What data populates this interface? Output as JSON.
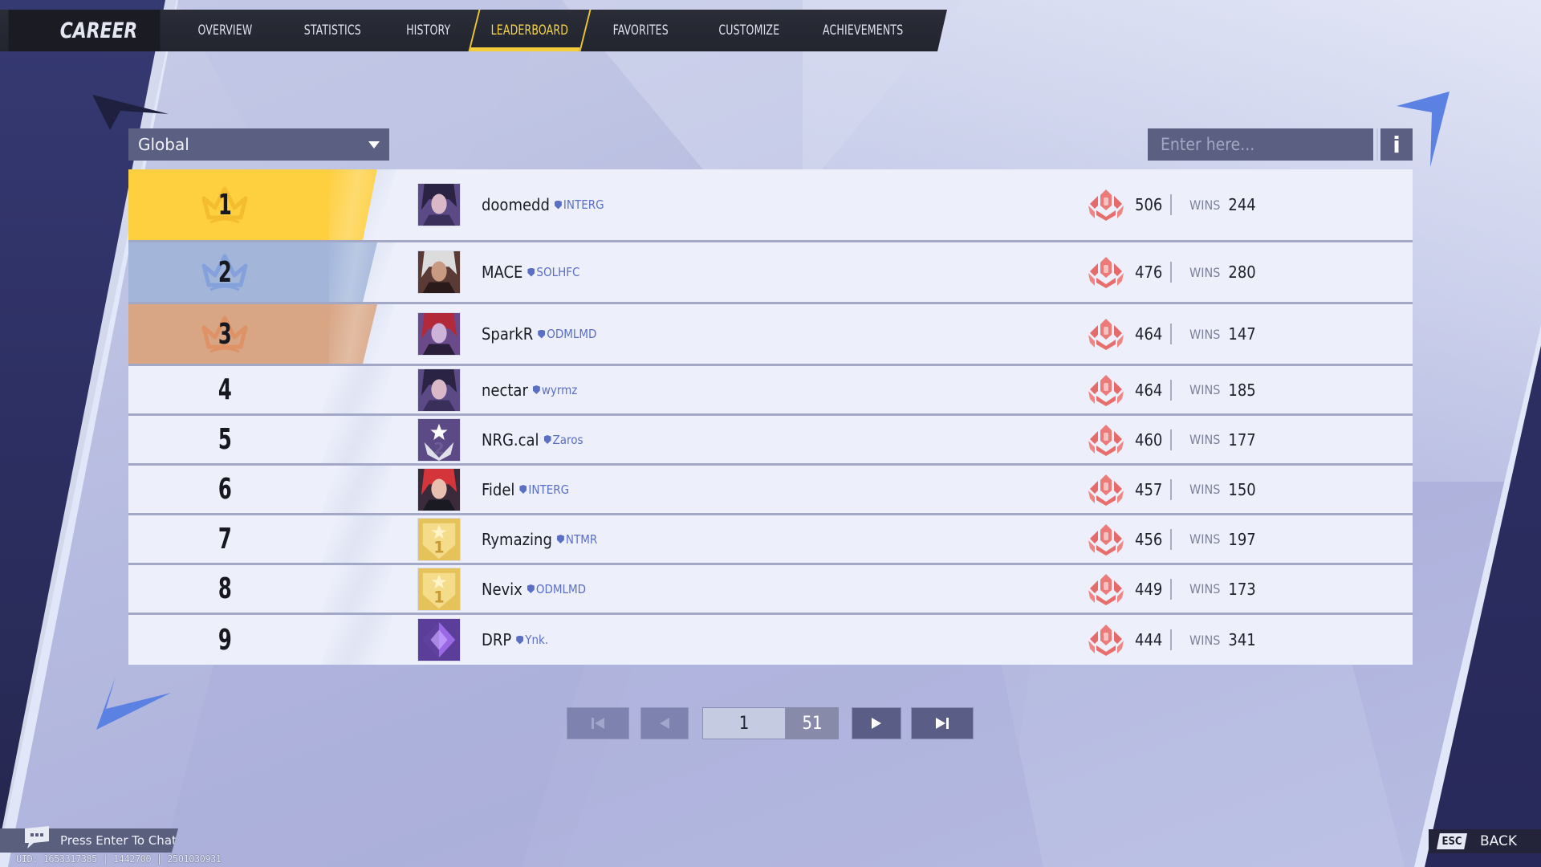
{
  "nav": {
    "title": "CAREER",
    "tabs": [
      {
        "label": "OVERVIEW",
        "active": false
      },
      {
        "label": "STATISTICS",
        "active": false
      },
      {
        "label": "HISTORY",
        "active": false
      },
      {
        "label": "LEADERBOARD",
        "active": true
      },
      {
        "label": "FAVORITES",
        "active": false
      },
      {
        "label": "CUSTOMIZE",
        "active": false
      },
      {
        "label": "ACHIEVEMENTS",
        "active": false
      }
    ]
  },
  "filter": {
    "selected": "Global",
    "icon": "chevron-down-icon"
  },
  "search": {
    "value": "",
    "placeholder": "Enter here...",
    "info_label": "i"
  },
  "leaderboard": {
    "wins_label": "WINS",
    "rank_colors": {
      "1": "#fecf3f",
      "2": "#a3b6da",
      "3": "#d8a685"
    },
    "rank_icon": "rank-emblem-icon",
    "rank_icon_color": "#e86e6e",
    "rows": [
      {
        "rank": "1",
        "name": "doomedd",
        "club": "INTERG",
        "avatar": "character-portrait-purple-hair",
        "score": "506",
        "wins": "244"
      },
      {
        "rank": "2",
        "name": "MACE",
        "club": "SOLHFC",
        "avatar": "character-portrait-white-hair",
        "score": "476",
        "wins": "280"
      },
      {
        "rank": "3",
        "name": "SparkR",
        "club": "ODMLMD",
        "avatar": "character-portrait-red-scarf",
        "score": "464",
        "wins": "147"
      },
      {
        "rank": "4",
        "name": "nectar",
        "club": "wyrmz",
        "avatar": "character-portrait-purple-hair",
        "score": "464",
        "wins": "185"
      },
      {
        "rank": "5",
        "name": "NRG.cal",
        "club": "Zaros",
        "avatar": "badge-stars-2",
        "score": "460",
        "wins": "177"
      },
      {
        "rank": "6",
        "name": "Fidel",
        "club": "INTERG",
        "avatar": "character-portrait-red-hair",
        "score": "457",
        "wins": "150"
      },
      {
        "rank": "7",
        "name": "Rymazing",
        "club": "NTMR",
        "avatar": "badge-gold-1",
        "score": "456",
        "wins": "197"
      },
      {
        "rank": "8",
        "name": "Nevix",
        "club": "ODMLMD",
        "avatar": "badge-gold-1",
        "score": "449",
        "wins": "173"
      },
      {
        "rank": "9",
        "name": "DRP",
        "club": "Ynk.",
        "avatar": "crystal-purple",
        "score": "444",
        "wins": "341"
      }
    ]
  },
  "pagination": {
    "current_page": "1",
    "total_pages": "51",
    "first_enabled": false,
    "prev_enabled": false,
    "next_enabled": true,
    "last_enabled": true
  },
  "chat": {
    "label": "Press Enter To Chat"
  },
  "footer": {
    "uid": "UID: 1653317385 | 1442700 | 2501030931",
    "back_key": "ESC",
    "back_label": "BACK"
  }
}
